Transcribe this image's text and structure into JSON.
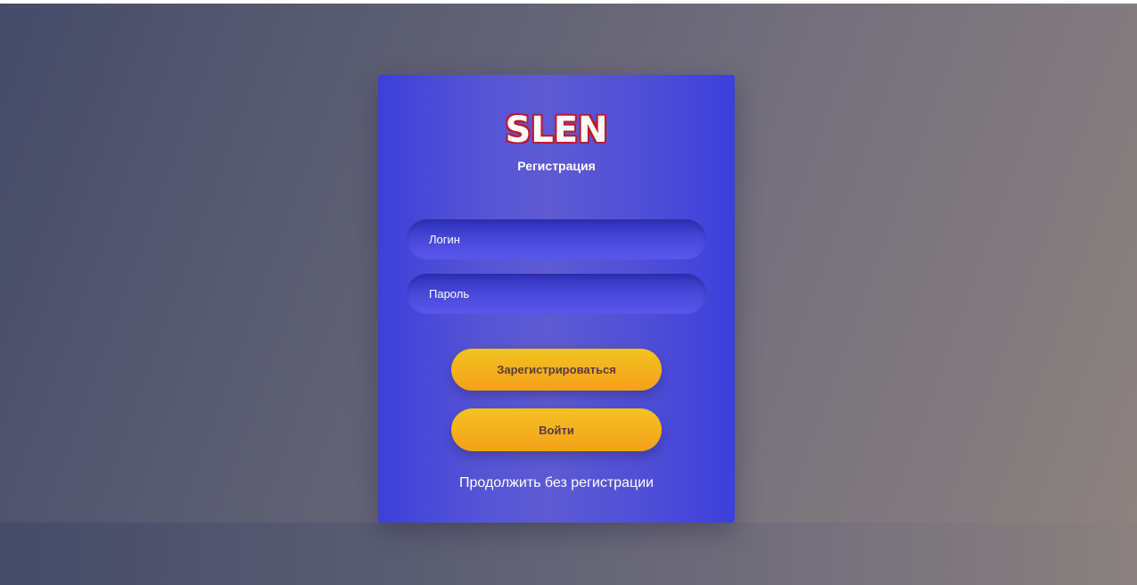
{
  "colors": {
    "card_primary": "#3d3fd8",
    "button_accent": "#f5a01a",
    "logo_outline": "#c0182b",
    "button_text": "#5a3a3e"
  },
  "header": {
    "logo": "SLEN",
    "subtitle": "Регистрация"
  },
  "form": {
    "login_placeholder": "Логин",
    "password_placeholder": "Пароль",
    "register_label": "Зарегистрироваться",
    "login_label": "Войти",
    "continue_label": "Продолжить без регистрации"
  }
}
